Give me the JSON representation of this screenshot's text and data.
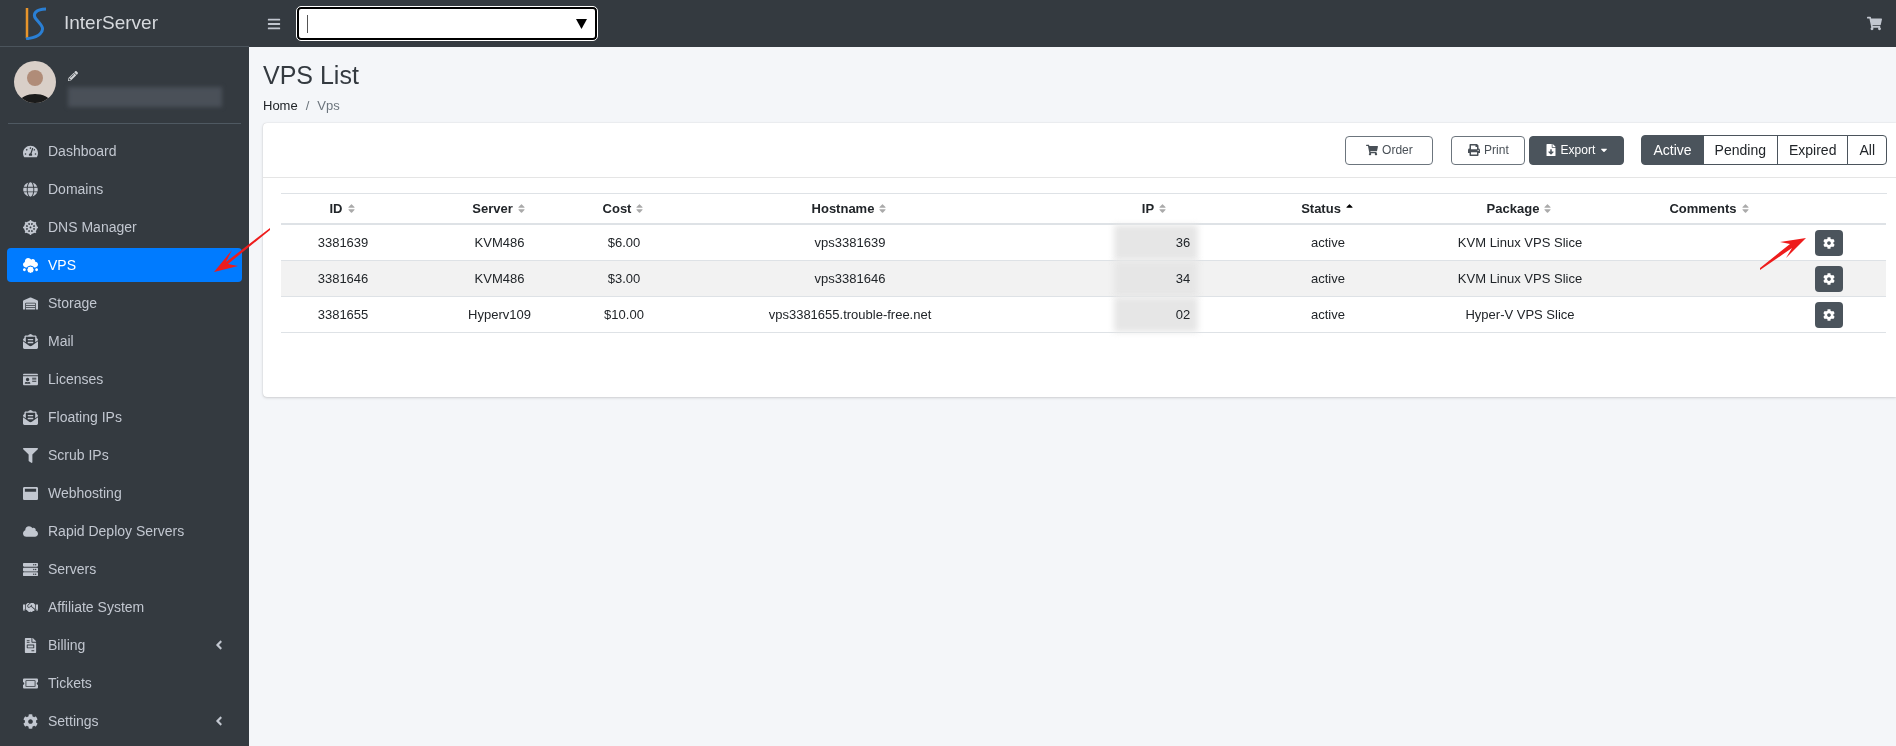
{
  "brand": {
    "name": "InterServer"
  },
  "sidebar": {
    "items": [
      {
        "label": "Dashboard",
        "selected": false,
        "has_submenu": false
      },
      {
        "label": "Domains",
        "selected": false,
        "has_submenu": false
      },
      {
        "label": "DNS Manager",
        "selected": false,
        "has_submenu": false
      },
      {
        "label": "VPS",
        "selected": true,
        "has_submenu": false
      },
      {
        "label": "Storage",
        "selected": false,
        "has_submenu": false
      },
      {
        "label": "Mail",
        "selected": false,
        "has_submenu": false
      },
      {
        "label": "Licenses",
        "selected": false,
        "has_submenu": false
      },
      {
        "label": "Floating IPs",
        "selected": false,
        "has_submenu": false
      },
      {
        "label": "Scrub IPs",
        "selected": false,
        "has_submenu": false
      },
      {
        "label": "Webhosting",
        "selected": false,
        "has_submenu": false
      },
      {
        "label": "Rapid Deploy Servers",
        "selected": false,
        "has_submenu": false
      },
      {
        "label": "Servers",
        "selected": false,
        "has_submenu": false
      },
      {
        "label": "Affiliate System",
        "selected": false,
        "has_submenu": false
      },
      {
        "label": "Billing",
        "selected": false,
        "has_submenu": true
      },
      {
        "label": "Tickets",
        "selected": false,
        "has_submenu": false
      },
      {
        "label": "Settings",
        "selected": false,
        "has_submenu": true
      }
    ]
  },
  "page": {
    "title": "VPS List",
    "breadcrumb": [
      "Home",
      "Vps"
    ],
    "breadcrumb_separator": "/"
  },
  "toolbar": {
    "buttons": [
      "Order",
      "Print",
      "Export"
    ],
    "filters": [
      {
        "label": "Active",
        "selected": true
      },
      {
        "label": "Pending",
        "selected": false
      },
      {
        "label": "Expired",
        "selected": false
      },
      {
        "label": "All",
        "selected": false
      }
    ]
  },
  "table": {
    "columns": [
      {
        "label": "ID",
        "sorted": false
      },
      {
        "label": "Server",
        "sorted": false
      },
      {
        "label": "Cost",
        "sorted": false
      },
      {
        "label": "Hostname",
        "sorted": false
      },
      {
        "label": "IP",
        "sorted": false
      },
      {
        "label": "Status",
        "sorted": true
      },
      {
        "label": "Package",
        "sorted": false
      },
      {
        "label": "Comments",
        "sorted": false
      }
    ],
    "rows": [
      {
        "cells": [
          "3381639",
          "KVM486",
          "$6.00",
          "vps3381639",
          "36",
          "active",
          "KVM Linux VPS Slice",
          ""
        ]
      },
      {
        "cells": [
          "3381646",
          "KVM486",
          "$3.00",
          "vps3381646",
          "34",
          "active",
          "KVM Linux VPS Slice",
          ""
        ]
      },
      {
        "cells": [
          "3381655",
          "Hyperv109",
          "$10.00",
          "vps3381655.trouble-free.net",
          "02",
          "active",
          "Hyper-V VPS Slice",
          ""
        ]
      }
    ]
  }
}
